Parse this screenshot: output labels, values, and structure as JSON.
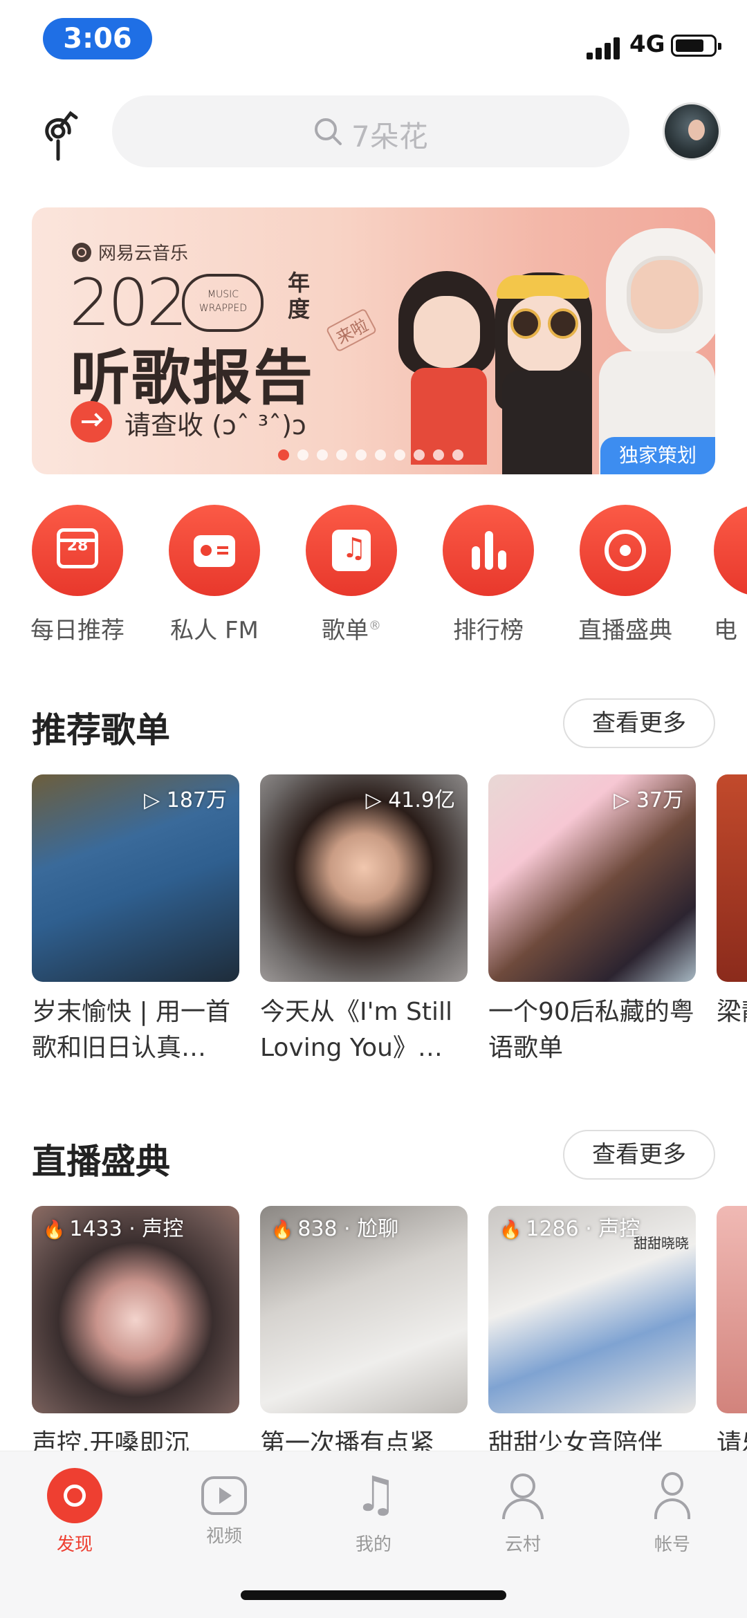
{
  "status_bar": {
    "time": "3:06",
    "network": "4G",
    "battery_level": 0.7
  },
  "search": {
    "placeholder": "7朵花"
  },
  "banner": {
    "brand": "网易云音乐",
    "year_left": "2",
    "year_mid": "2",
    "mark_line1": "MUSIC",
    "mark_line2": "WRAPPED",
    "year_suffix_1": "年",
    "year_suffix_2": "度",
    "headline": "听歌报告",
    "stamp": "来啦",
    "cta": "请查收 (ɔˆ ³ˆ)ɔ",
    "badge": "独家策划",
    "page_dots": 10,
    "active_dot": 0
  },
  "quick_entries": [
    {
      "label": "每日推荐",
      "icon": "calendar-icon",
      "icon_text": "28"
    },
    {
      "label": "私人 FM",
      "icon": "radio-icon"
    },
    {
      "label": "歌单",
      "icon": "playlist-icon",
      "mark": "®"
    },
    {
      "label": "排行榜",
      "icon": "chart-bars-icon"
    },
    {
      "label": "直播盛典",
      "icon": "live-icon"
    },
    {
      "label": "电",
      "icon": "partial-icon"
    }
  ],
  "recommend": {
    "title": "推荐歌单",
    "more": "查看更多",
    "cards": [
      {
        "plays": "187万",
        "title": "岁末愉快 | 用一首歌和旧日认真…"
      },
      {
        "plays": "41.9亿",
        "title": "今天从《I'm Still Loving You》…"
      },
      {
        "plays": "37万",
        "title": "一个90后私藏的粤语歌单"
      },
      {
        "plays": "",
        "title": "梁静"
      }
    ]
  },
  "live": {
    "title": "直播盛典",
    "more": "查看更多",
    "cards": [
      {
        "tag": "1433 · 声控",
        "title": "声控,开嗓即沉"
      },
      {
        "tag": "838 · 尬聊",
        "title": "第一次播有点紧"
      },
      {
        "tag": "1286 · 声控",
        "title": "甜甜少女音陪伴",
        "corner": "甜甜晓晓"
      },
      {
        "tag": "",
        "title": "请乐"
      }
    ]
  },
  "tabbar": [
    {
      "label": "发现",
      "icon": "discover-icon",
      "active": true
    },
    {
      "label": "视频",
      "icon": "video-icon",
      "active": false
    },
    {
      "label": "我的",
      "icon": "music-note-icon",
      "active": false
    },
    {
      "label": "云村",
      "icon": "community-icon",
      "active": false
    },
    {
      "label": "帐号",
      "icon": "account-icon",
      "active": false
    }
  ],
  "colors": {
    "accent": "#ee3f31",
    "badge_blue": "#3d8df0",
    "time_pill": "#1f6fe5"
  }
}
